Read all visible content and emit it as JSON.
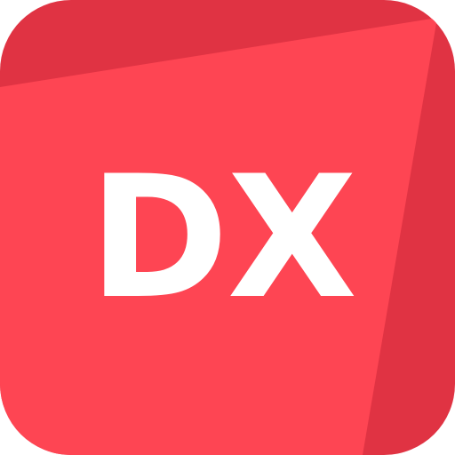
{
  "logo": {
    "text": "DX",
    "colors": {
      "main": "#fe4553",
      "dark_band": "#e03343",
      "text": "#ffffff",
      "background": "#ffffff"
    }
  }
}
